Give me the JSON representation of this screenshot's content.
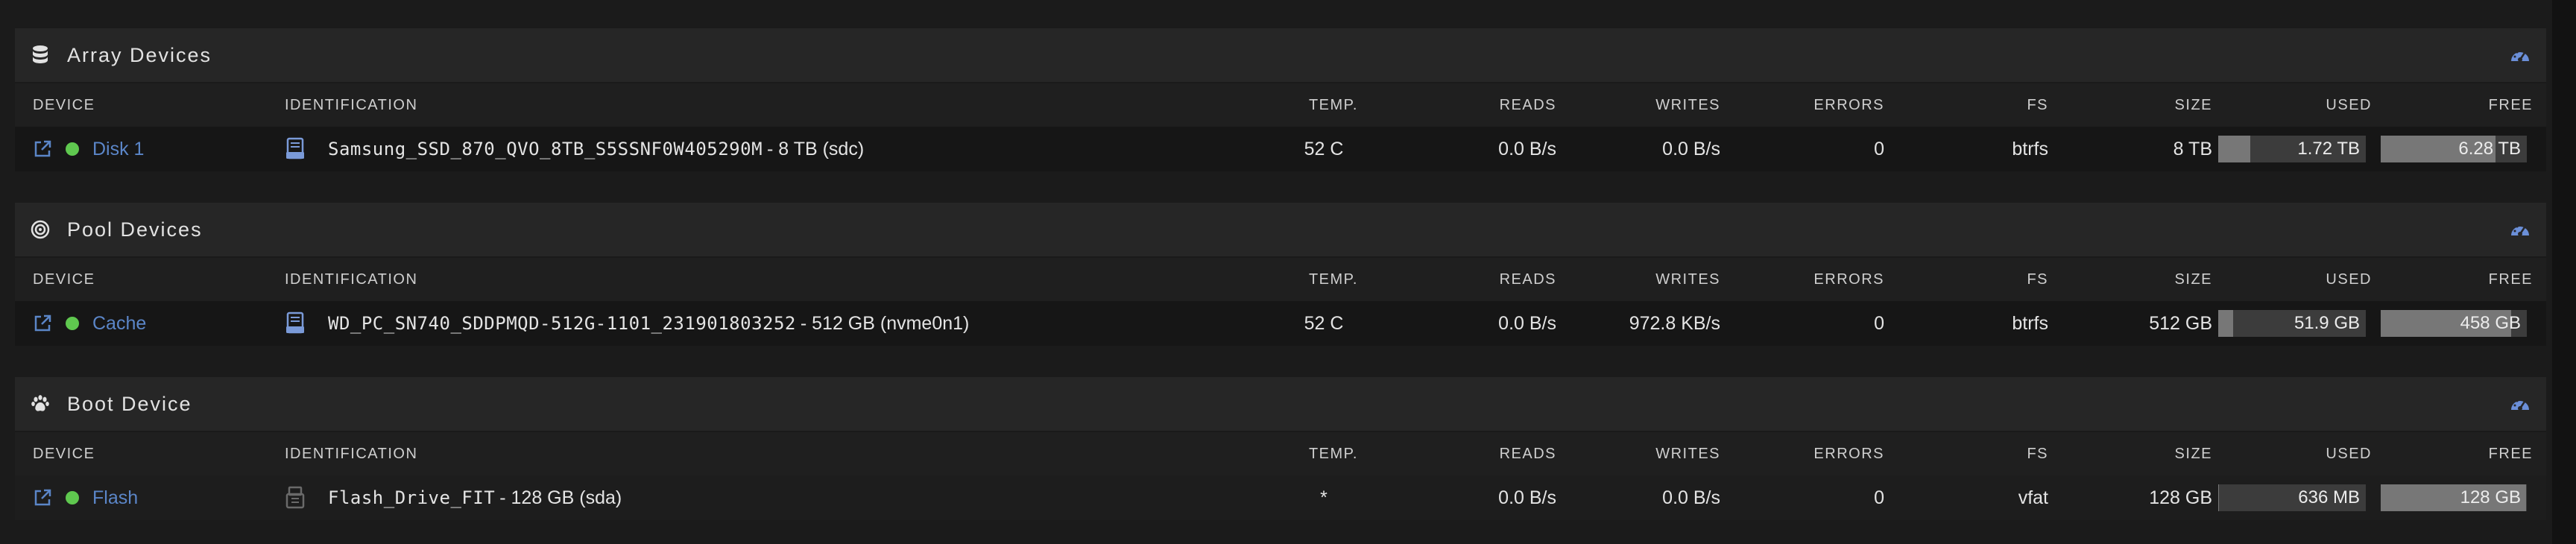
{
  "columns": {
    "device": "DEVICE",
    "identification": "IDENTIFICATION",
    "temp": "TEMP.",
    "reads": "READS",
    "writes": "WRITES",
    "errors": "ERRORS",
    "fs": "FS",
    "size": "SIZE",
    "used": "USED",
    "free": "FREE"
  },
  "sections": {
    "array": {
      "title": "Array Devices",
      "icon": "database-icon",
      "device": {
        "name": "Disk 1",
        "status": "online",
        "status_color": "#5fc84f",
        "ident_name": "Samsung_SSD_870_QVO_8TB_S5SSNF0W405290M",
        "ident_extra": "- 8 TB (sdc)",
        "temp": "52 C",
        "reads": "0.0 B/s",
        "writes": "0.0 B/s",
        "errors": "0",
        "fs": "btrfs",
        "size": "8 TB",
        "used": "1.72 TB",
        "free": "6.28 TB",
        "used_fraction": 0.215,
        "free_fraction": 0.785
      }
    },
    "pool": {
      "title": "Pool Devices",
      "icon": "target-icon",
      "device": {
        "name": "Cache",
        "status": "online",
        "status_color": "#5fc84f",
        "ident_name": "WD_PC_SN740_SDDPMQD-512G-1101_231901803252",
        "ident_extra": "- 512 GB (nvme0n1)",
        "temp": "52 C",
        "reads": "0.0 B/s",
        "writes": "972.8 KB/s",
        "errors": "0",
        "fs": "btrfs",
        "size": "512 GB",
        "used": "51.9 GB",
        "free": "458 GB",
        "used_fraction": 0.101,
        "free_fraction": 0.895
      }
    },
    "boot": {
      "title": "Boot Device",
      "icon": "paw-icon",
      "device": {
        "name": "Flash",
        "status": "online",
        "status_color": "#5fc84f",
        "ident_name": "Flash_Drive_FIT",
        "ident_extra": "- 128 GB (sda)",
        "temp": "*",
        "reads": "0.0 B/s",
        "writes": "0.0 B/s",
        "errors": "0",
        "fs": "vfat",
        "size": "128 GB",
        "used": "636 MB",
        "free": "128 GB",
        "used_fraction": 0.005,
        "free_fraction": 0.995
      }
    }
  },
  "colors": {
    "link": "#5b86c8",
    "status_online": "#5fc84f",
    "dashboard_icon": "#6b8fd8"
  }
}
